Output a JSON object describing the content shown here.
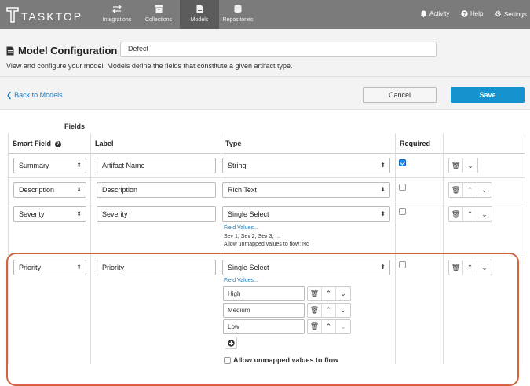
{
  "nav": {
    "brand": "TASKTOP",
    "tabs": [
      {
        "label": "Integrations",
        "icon": "arrows-icon"
      },
      {
        "label": "Collections",
        "icon": "archive-icon"
      },
      {
        "label": "Models",
        "icon": "document-icon"
      },
      {
        "label": "Repositories",
        "icon": "database-icon"
      }
    ],
    "activity": "Activity",
    "help": "Help",
    "settings": "Settings"
  },
  "header": {
    "title": "Model Configuration",
    "model_name": "Defect",
    "description": "View and configure your model. Models define the fields that constitute a given artifact type."
  },
  "actions": {
    "back": "Back to Models",
    "cancel": "Cancel",
    "save": "Save"
  },
  "table": {
    "section_title": "Fields",
    "columns": {
      "smart_field": "Smart Field",
      "label": "Label",
      "type": "Type",
      "required": "Required"
    },
    "rows": [
      {
        "smart_field": "Summary",
        "label": "Artifact Name",
        "type": "String",
        "required": true
      },
      {
        "smart_field": "Description",
        "label": "Description",
        "type": "Rich Text",
        "required": false
      },
      {
        "smart_field": "Severity",
        "label": "Severity",
        "type": "Single Select",
        "required": false,
        "field_values_link": "Field Values...",
        "values_summary": "Sev 1, Sev 2, Sev 3, …",
        "unmapped_note": "Allow unmapped values to flow: No"
      },
      {
        "smart_field": "Priority",
        "label": "Priority",
        "type": "Single Select",
        "required": false,
        "field_values_link": "Field Values...",
        "values": [
          "High",
          "Medium",
          "Low"
        ],
        "unmapped_label": "Allow unmapped values to flow"
      }
    ]
  },
  "colors": {
    "nav_bg": "#7b7b7b",
    "accent": "#1593cf",
    "link": "#1a7ab8",
    "highlight": "#d9623e"
  }
}
